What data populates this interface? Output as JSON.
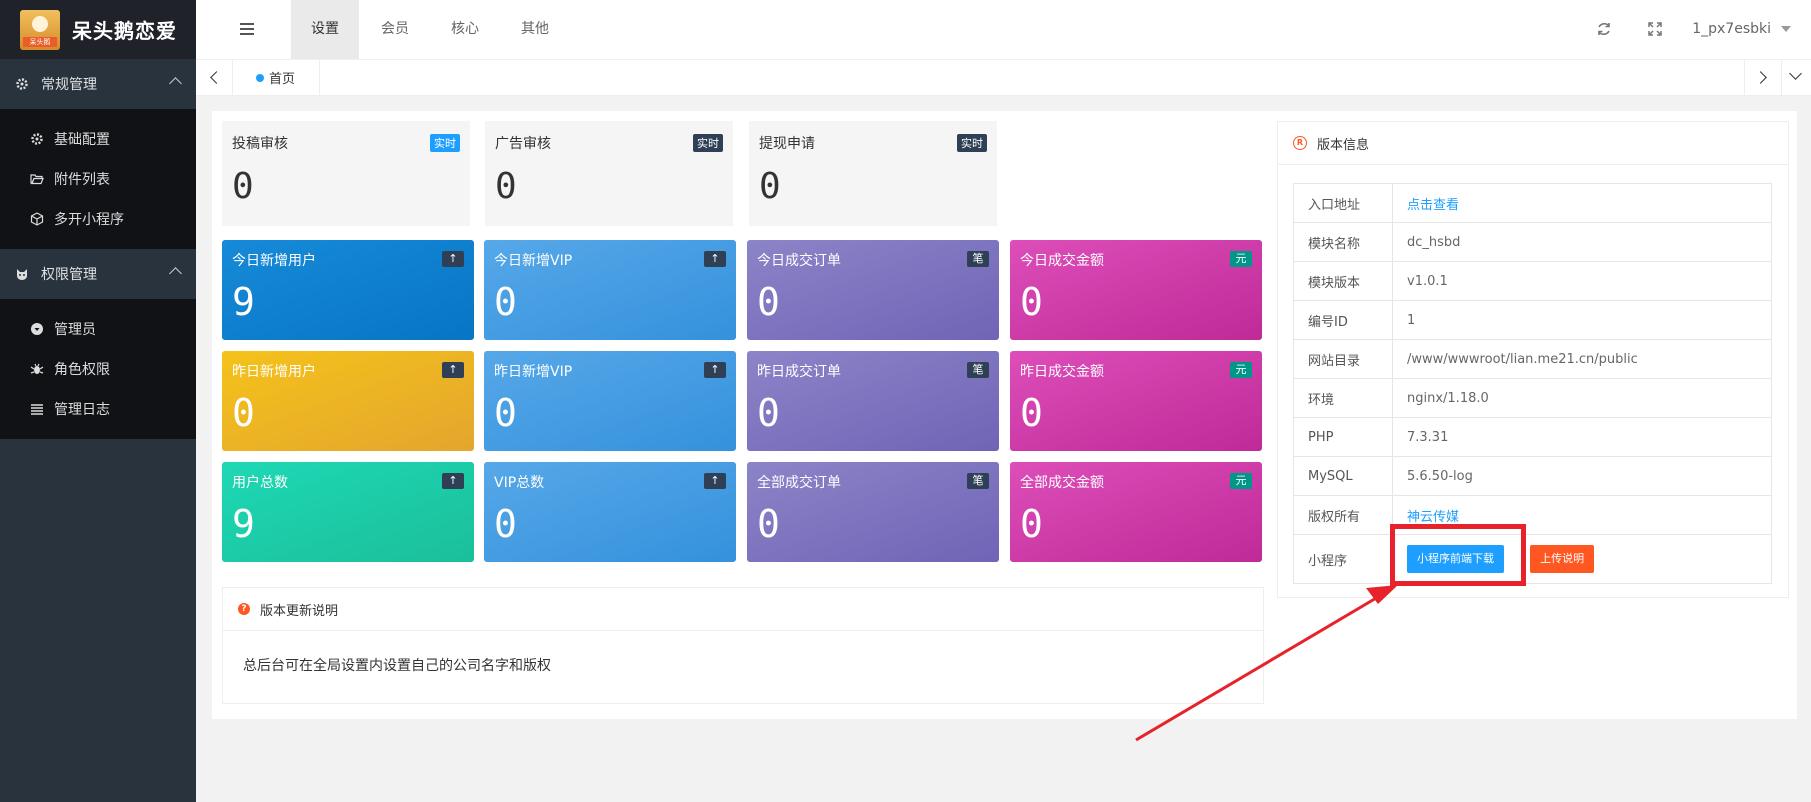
{
  "app": {
    "title": "呆头鹅恋爱",
    "logo_tag": "呆头鹅"
  },
  "header": {
    "tabs": [
      "设置",
      "会员",
      "核心",
      "其他"
    ],
    "active_tab": "设置",
    "user": "1_px7esbki",
    "icons": [
      "menu-toggle-icon",
      "refresh-icon",
      "fullscreen-icon"
    ]
  },
  "tabbar": {
    "home_label": "首页"
  },
  "sidebar": {
    "groups": [
      {
        "label": "常规管理",
        "icon": "gear-icon",
        "items": [
          {
            "label": "基础配置",
            "icon": "gear-icon"
          },
          {
            "label": "附件列表",
            "icon": "folder-open-icon"
          },
          {
            "label": "多开小程序",
            "icon": "cube-icon"
          }
        ]
      },
      {
        "label": "权限管理",
        "icon": "cat-icon",
        "items": [
          {
            "label": "管理员",
            "icon": "user-circle-icon"
          },
          {
            "label": "角色权限",
            "icon": "bug-icon"
          },
          {
            "label": "管理日志",
            "icon": "list-icon"
          }
        ]
      }
    ]
  },
  "review": [
    {
      "label": "投稿审核",
      "badge": "实时",
      "value": "0",
      "badge_color": "#1e9fff"
    },
    {
      "label": "广告审核",
      "badge": "实时",
      "value": "0",
      "badge_color": "#2f4056"
    },
    {
      "label": "提现申请",
      "badge": "实时",
      "value": "0",
      "badge_color": "#2f4056"
    }
  ],
  "stats": [
    {
      "label": "今日新增用户",
      "badge": "↑",
      "value": "9"
    },
    {
      "label": "今日新增VIP",
      "badge": "↑",
      "value": "0"
    },
    {
      "label": "今日成交订单",
      "badge": "笔",
      "value": "0"
    },
    {
      "label": "今日成交金额",
      "badge": "元",
      "value": "0"
    },
    {
      "label": "昨日新增用户",
      "badge": "↑",
      "value": "0"
    },
    {
      "label": "昨日新增VIP",
      "badge": "↑",
      "value": "0"
    },
    {
      "label": "昨日成交订单",
      "badge": "笔",
      "value": "0"
    },
    {
      "label": "昨日成交金额",
      "badge": "元",
      "value": "0"
    },
    {
      "label": "用户总数",
      "badge": "↑",
      "value": "9"
    },
    {
      "label": "VIP总数",
      "badge": "↑",
      "value": "0"
    },
    {
      "label": "全部成交订单",
      "badge": "笔",
      "value": "0"
    },
    {
      "label": "全部成交金额",
      "badge": "元",
      "value": "0"
    }
  ],
  "update_panel": {
    "title": "版本更新说明",
    "text": "总后台可在全局设置内设置自己的公司名字和版权"
  },
  "version_panel": {
    "title": "版本信息",
    "rows": [
      {
        "key": "入口地址",
        "value": "点击查看"
      },
      {
        "key": "模块名称",
        "value": "dc_hsbd"
      },
      {
        "key": "模块版本",
        "value": "v1.0.1"
      },
      {
        "key": "编号ID",
        "value": "1"
      },
      {
        "key": "网站目录",
        "value": "/www/wwwroot/lian.me21.cn/public"
      },
      {
        "key": "环境",
        "value": "nginx/1.18.0"
      },
      {
        "key": "PHP",
        "value": "7.3.31"
      },
      {
        "key": "MySQL",
        "value": "5.6.50-log"
      },
      {
        "key": "版权所有",
        "value": "神云传媒"
      }
    ],
    "mini_program_label": "小程序",
    "download_button": "小程序前端下载",
    "upload_button": "上传说明"
  },
  "colors": {
    "sidebar": "#28333e",
    "accent": "#1e9fff",
    "orange": "#ff5722",
    "annotation": "#e8222a"
  }
}
